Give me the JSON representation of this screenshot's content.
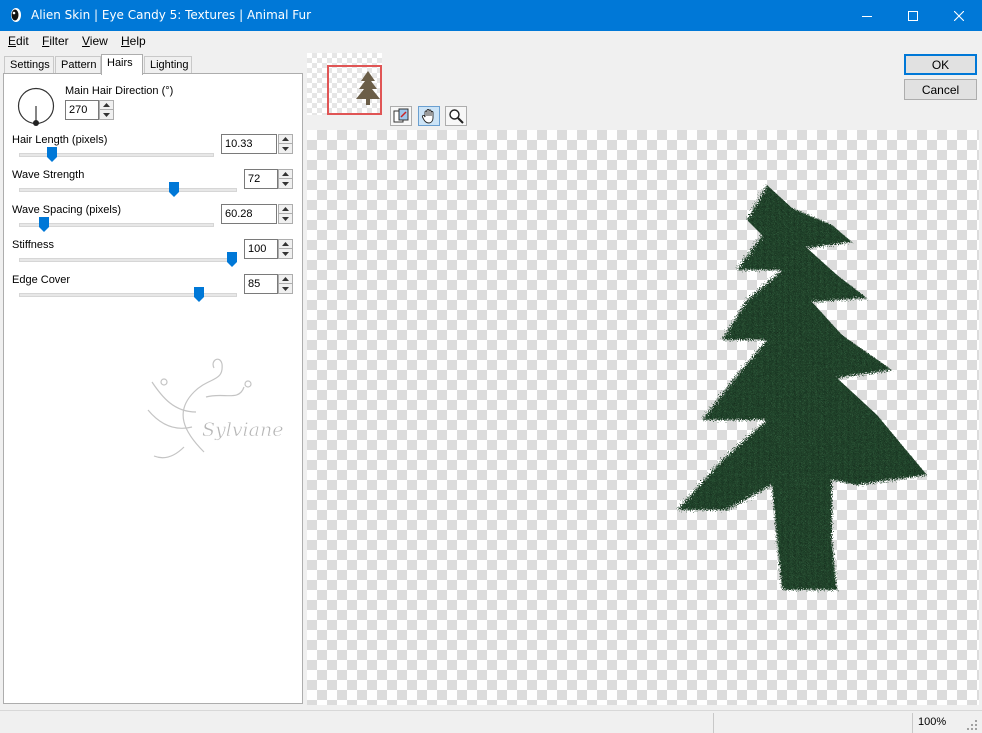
{
  "window": {
    "title": "Alien Skin | Eye Candy 5: Textures | Animal Fur"
  },
  "menu": {
    "items": [
      {
        "first": "E",
        "rest": "dit"
      },
      {
        "first": "F",
        "rest": "ilter"
      },
      {
        "first": "V",
        "rest": "iew"
      },
      {
        "first": "H",
        "rest": "elp"
      }
    ]
  },
  "tabs": [
    "Settings",
    "Pattern",
    "Hairs",
    "Lighting"
  ],
  "active_tab": "Hairs",
  "hairs": {
    "direction_label": "Main Hair Direction (°)",
    "direction_value": "270",
    "sliders": [
      {
        "label": "Hair Length (pixels)",
        "value": "10.33",
        "position": 0.15
      },
      {
        "label": "Wave Strength",
        "value": "72",
        "position": 0.72
      },
      {
        "label": "Wave Spacing (pixels)",
        "value": "60.28",
        "position": 0.11
      },
      {
        "label": "Stiffness",
        "value": "100",
        "position": 1.0
      },
      {
        "label": "Edge Cover",
        "value": "85",
        "position": 0.84
      }
    ]
  },
  "watermark": {
    "signature": "Sylviane"
  },
  "buttons": {
    "ok": "OK",
    "cancel": "Cancel"
  },
  "tools": [
    "compare-preview-icon",
    "hand-pan-icon",
    "zoom-magnifier-icon"
  ],
  "status": {
    "zoom": "100%"
  },
  "colors": {
    "titlebar": "#0078d7",
    "slider_thumb": "#0078d7",
    "navigator_frame": "#e05555",
    "fur_green": "#1f3d27"
  }
}
